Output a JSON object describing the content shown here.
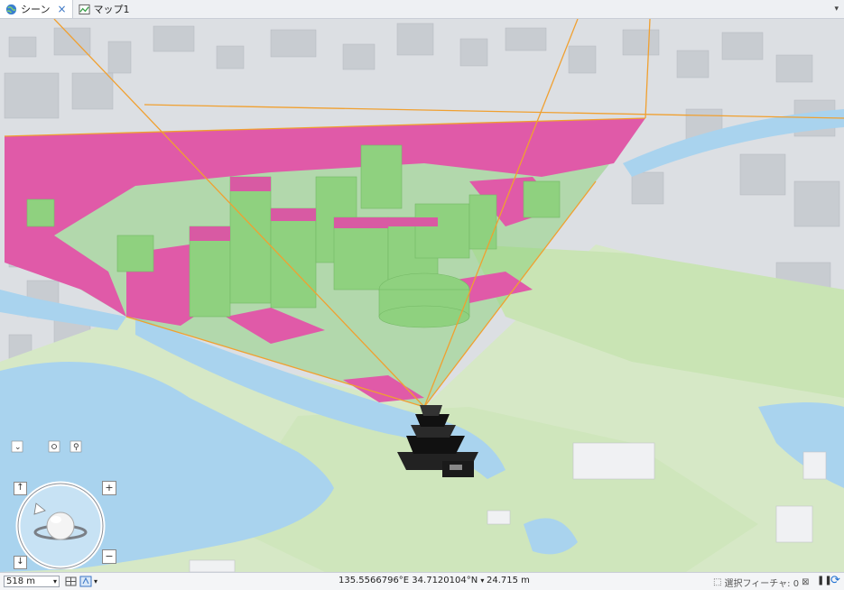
{
  "tabs": [
    {
      "label": "シーン",
      "close": "×",
      "active": true
    },
    {
      "label": "マップ1",
      "active": false
    }
  ],
  "status": {
    "scale": "518 m",
    "coordinates": "135.5566796°E 34.7120104°N",
    "elevation": "24.715 m",
    "selected_features": "選択フィーチャ: 0"
  },
  "nav_controls": {
    "zoom_in": "+",
    "zoom_out": "−",
    "up": "↑",
    "down": "↓"
  },
  "colors": {
    "visible": "#8fd17f",
    "not_visible": "#e05aa8",
    "sightline": "#f0a030",
    "water": "#a9d3ee",
    "park": "#c9e4b4"
  }
}
